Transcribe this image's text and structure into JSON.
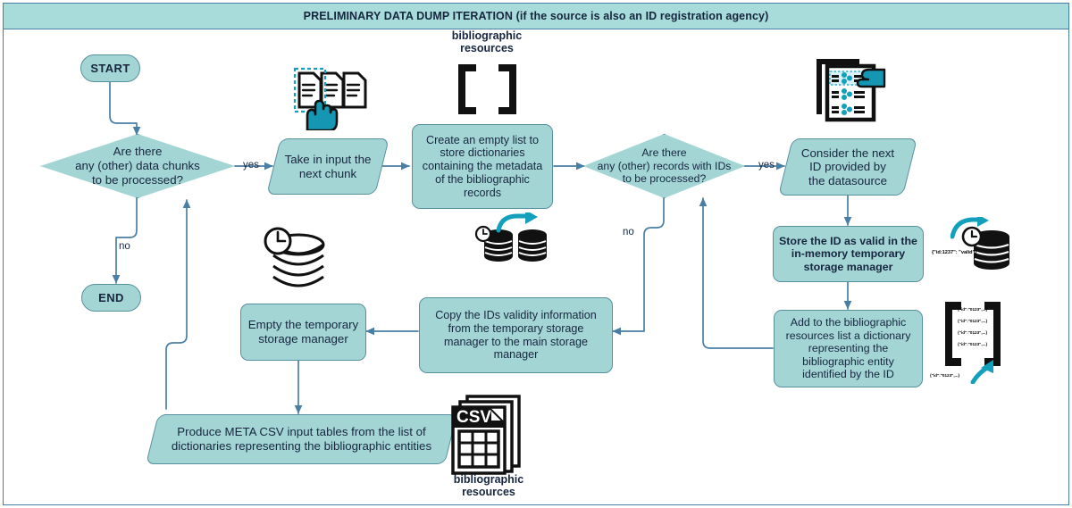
{
  "header": {
    "title": "PRELIMINARY DATA DUMP ITERATION (if the source is also an ID registration agency)"
  },
  "colors": {
    "node_fill": "#a4d5d5",
    "node_border": "#57909e",
    "header_fill": "#a8dcda",
    "frame_border": "#4a7fa5",
    "text": "#16263f",
    "arrow": "#4a7fa5",
    "accent_teal": "#12a0bd",
    "icon_black": "#111111"
  },
  "nodes": {
    "start": "START",
    "end": "END",
    "decision_chunks": "Are there\nany (other) data chunks\nto be processed?",
    "take_input": "Take in input the\nnext chunk",
    "create_list": "Create an empty list to\nstore dictionaries\ncontaining the metadata\nof the bibliographic\nrecords",
    "decision_records": "Are there\nany (other) records with IDs\nto be processed?",
    "consider_id": "Consider the next\nID provided by\nthe datasource",
    "store_id": "Store the ID as valid in the\nin-memory temporary\nstorage manager",
    "add_dict": "Add to the bibliographic\nresources list a dictionary\nrepresenting the\nbibliographic entity\nidentified by the ID",
    "copy_validity": "Copy the IDs validity information\nfrom the temporary storage\nmanager to the main storage\nmanager",
    "empty_temp": "Empty the temporary\nstorage manager",
    "produce_csv": "Produce META CSV input tables from the list of\ndictionaries representing the bibliographic entities"
  },
  "edge_labels": {
    "yes_chunks": "yes",
    "no_chunks": "no",
    "yes_records": "yes",
    "no_records": "no"
  },
  "icon_captions": {
    "bibliographic_resources_top": "bibliographic\nresources",
    "bibliographic_resources_bottom": "bibliographic\nresources"
  },
  "icons": {
    "documents_stack": "documents-stack-icon",
    "pointing_hand": "pointing-hand-icon",
    "empty_list_brackets": "empty-list-brackets-icon",
    "records_document": "records-document-icon",
    "temporary_db_clock": "temporary-database-clock-icon",
    "db_copy_pair": "database-copy-pair-icon",
    "empty_db_clock": "empty-database-clock-icon",
    "csv_files": "csv-files-icon",
    "dict_list_brackets": "dictionary-list-brackets-icon"
  },
  "icon_text": {
    "id_valid_dict": "{\"id:1237\": \"valid\"}",
    "entity_dict": "{\"id\":\"0123\",...}",
    "entity_dict_rows": [
      "{\"id\":\"0123\",...}",
      "{\"id\":\"0123\",...}",
      "{\"id\":\"0123\",...}",
      "{\"id\":\"0123\",...}"
    ]
  }
}
